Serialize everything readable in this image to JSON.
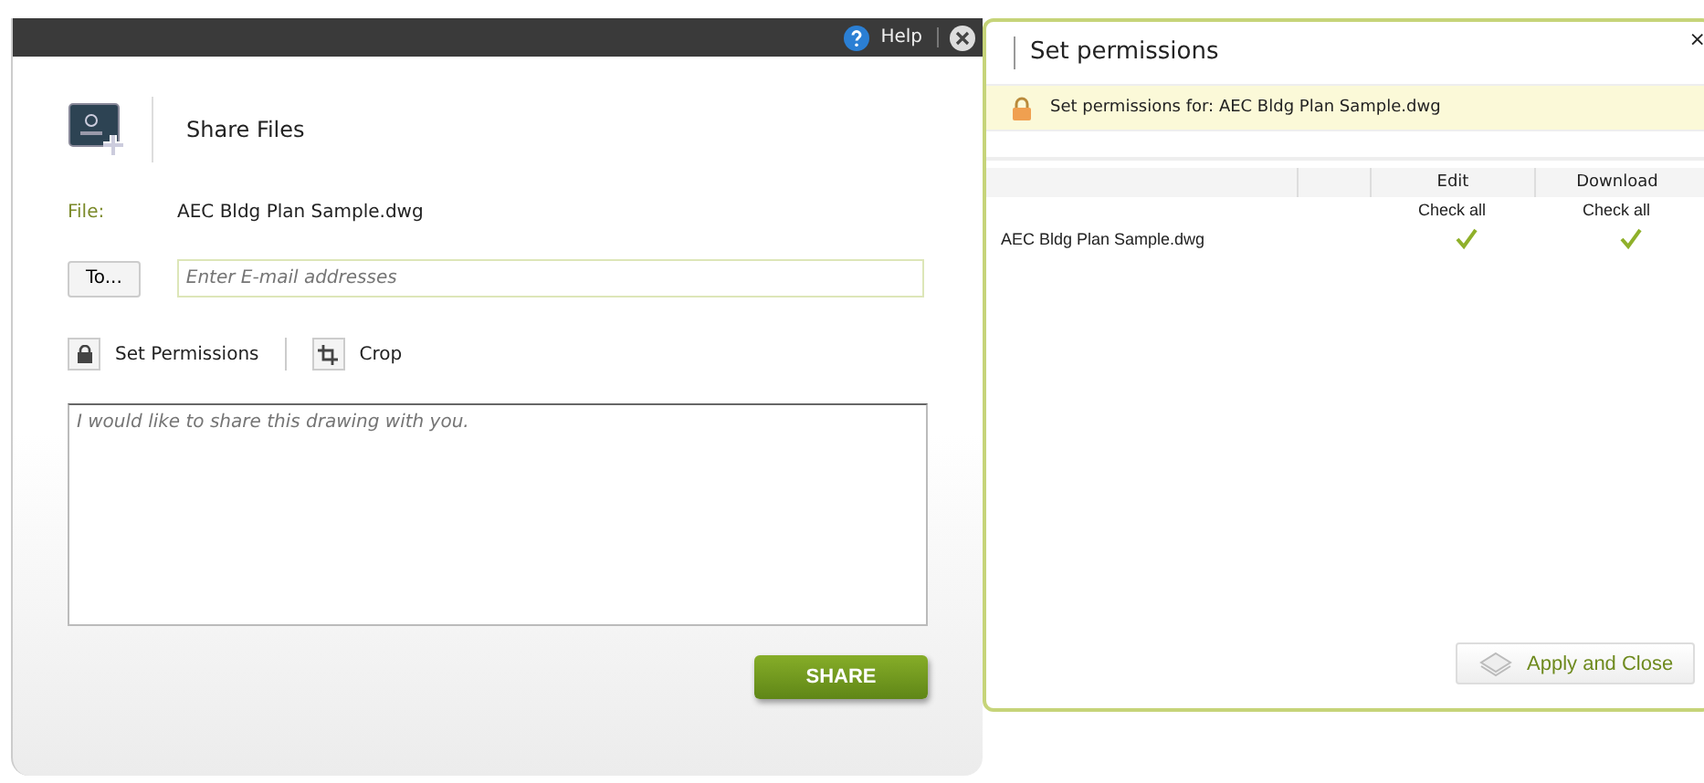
{
  "share_dialog": {
    "help": "Help",
    "title": "Share Files",
    "file_label": "File:",
    "file_name": "AEC Bldg Plan Sample.dwg",
    "to_button": "To...",
    "email_field": {
      "placeholder": "Enter E-mail addresses"
    },
    "actions": [
      {
        "kind": "lock",
        "label": "Set Permissions"
      },
      {
        "kind": "crop",
        "label": "Crop"
      }
    ],
    "message_field": {
      "placeholder": "I would like to share this drawing with you."
    },
    "share_button": "SHARE"
  },
  "permissions_panel": {
    "title": "Set permissions",
    "close": "×",
    "notice": "Set permissions for: AEC Bldg Plan Sample.dwg",
    "columns": [
      "Edit",
      "Download"
    ],
    "check_all": [
      "Check all",
      "Check all"
    ],
    "rows": [
      {
        "name": "AEC Bldg Plan Sample.dwg",
        "edit": true,
        "download": true
      }
    ],
    "apply_button": "Apply and Close"
  }
}
